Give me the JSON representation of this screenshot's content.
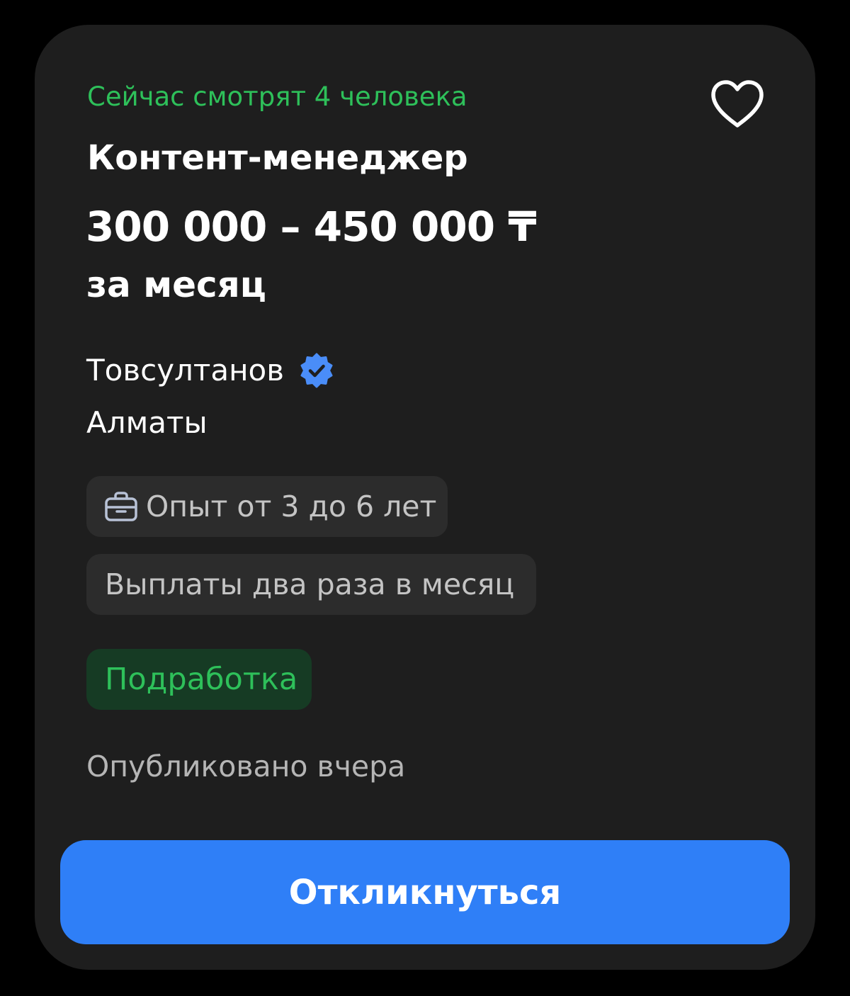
{
  "vacancy": {
    "watchers_text": "Сейчас смотрят 4 человека",
    "title": "Контент-менеджер",
    "salary_range": "300 000 – 450 000 ₸",
    "salary_period": "за месяц",
    "employer": "Товсултанов",
    "employer_verified": true,
    "city": "Алматы",
    "experience": "Опыт от 3 до 6 лет",
    "payment_schedule": "Выплаты два раза в месяц",
    "employment_tag": "Подработка",
    "published": "Опубликовано вчера",
    "respond_label": "Откликнуться"
  },
  "icons": {
    "favorite": "heart-outline-icon",
    "verified": "verified-badge-icon",
    "experience": "briefcase-icon"
  },
  "colors": {
    "background": "#000000",
    "card": "#1e1e1e",
    "accent_green": "#2ec05a",
    "green_chip_bg": "#163b24",
    "chip_bg": "#2c2c2c",
    "primary_button": "#2f7ff7",
    "verified_badge": "#4a8df8"
  }
}
